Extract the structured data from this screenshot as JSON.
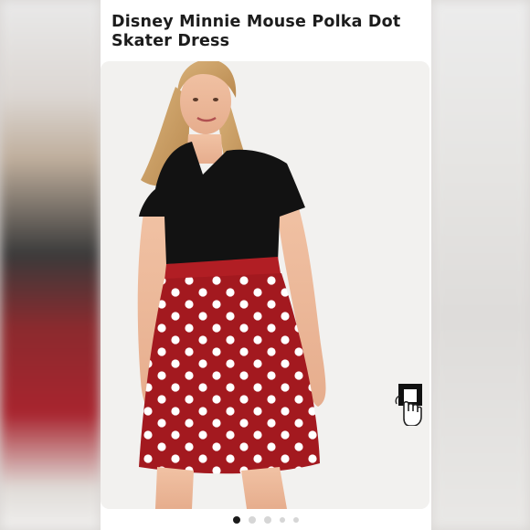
{
  "listing": {
    "title": "Disney Minnie Mouse Polka Dot Skater Dress"
  },
  "photo": {
    "image_name": "model-wearing-polka-dot-dress"
  },
  "share": {
    "icon": "tap-gesture-icon"
  },
  "carousel": {
    "total": 5,
    "active_index": 0
  },
  "colors": {
    "dress_red": "#a3191f",
    "top_black": "#121212",
    "dots_white": "#ffffff"
  }
}
